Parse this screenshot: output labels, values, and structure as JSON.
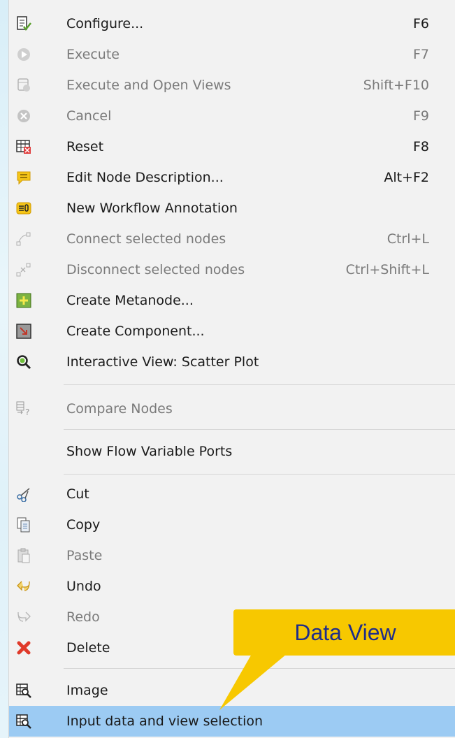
{
  "menu": {
    "items": [
      {
        "label": "Configure...",
        "shortcut": "F6",
        "icon": "configure-icon",
        "enabled": true
      },
      {
        "label": "Execute",
        "shortcut": "F7",
        "icon": "execute-icon",
        "enabled": false
      },
      {
        "label": "Execute and Open Views",
        "shortcut": "Shift+F10",
        "icon": "execute-open-views-icon",
        "enabled": false
      },
      {
        "label": "Cancel",
        "shortcut": "F9",
        "icon": "cancel-icon",
        "enabled": false
      },
      {
        "label": "Reset",
        "shortcut": "F8",
        "icon": "reset-icon",
        "enabled": true
      },
      {
        "label": "Edit Node Description...",
        "shortcut": "Alt+F2",
        "icon": "node-description-icon",
        "enabled": true
      },
      {
        "label": "New Workflow Annotation",
        "shortcut": "",
        "icon": "workflow-annotation-icon",
        "enabled": true
      },
      {
        "label": "Connect selected nodes",
        "shortcut": "Ctrl+L",
        "icon": "connect-nodes-icon",
        "enabled": false
      },
      {
        "label": "Disconnect selected nodes",
        "shortcut": "Ctrl+Shift+L",
        "icon": "disconnect-nodes-icon",
        "enabled": false
      },
      {
        "label": "Create Metanode...",
        "shortcut": "",
        "icon": "create-metanode-icon",
        "enabled": true
      },
      {
        "label": "Create Component...",
        "shortcut": "",
        "icon": "create-component-icon",
        "enabled": true
      },
      {
        "label": "Interactive View: Scatter Plot",
        "shortcut": "",
        "icon": "magnifier-icon",
        "enabled": true
      },
      {
        "label": "Compare Nodes",
        "shortcut": "",
        "icon": "compare-nodes-icon",
        "enabled": false
      },
      {
        "label": "Show Flow Variable Ports",
        "shortcut": "",
        "icon": "",
        "enabled": true
      },
      {
        "label": "Cut",
        "shortcut": "",
        "icon": "scissors-icon",
        "enabled": true
      },
      {
        "label": "Copy",
        "shortcut": "",
        "icon": "copy-icon",
        "enabled": true
      },
      {
        "label": "Paste",
        "shortcut": "",
        "icon": "paste-icon",
        "enabled": false
      },
      {
        "label": "Undo",
        "shortcut": "",
        "icon": "undo-icon",
        "enabled": true
      },
      {
        "label": "Redo",
        "shortcut": "",
        "icon": "redo-icon",
        "enabled": false
      },
      {
        "label": "Delete",
        "shortcut": "",
        "icon": "delete-icon",
        "enabled": true
      },
      {
        "label": "Image",
        "shortcut": "",
        "icon": "table-view-icon",
        "enabled": true
      },
      {
        "label": "Input data and view selection",
        "shortcut": "",
        "icon": "table-view-icon",
        "enabled": true,
        "selected": true
      }
    ]
  },
  "callout": {
    "text": "Data View"
  },
  "colors": {
    "selection": "#9ccbf3",
    "callout": "#f7c800",
    "callout_text": "#1f2d8a",
    "menu_bg": "#f2f2f2"
  }
}
